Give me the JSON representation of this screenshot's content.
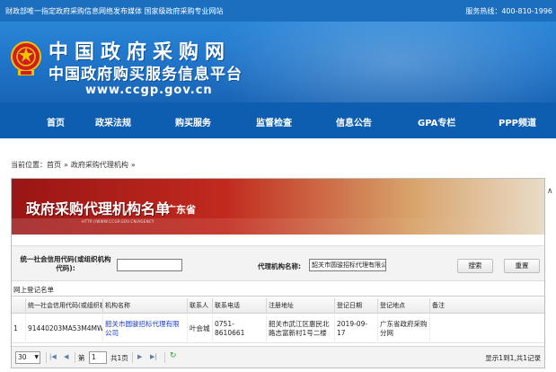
{
  "topbar": {
    "left_text": "财政部唯一指定政府采购信息网络发布媒体  国家级政府采购专业网站",
    "hotline": "服务热线：400-810-1996"
  },
  "banner": {
    "title_main": "中国政府采购网",
    "title_sub": "中国政府购买服务信息平台",
    "url": "www.ccgp.gov.cn"
  },
  "nav": {
    "items": [
      "首页",
      "政采法规",
      "购买服务",
      "监督检查",
      "信息公告",
      "GPA专栏",
      "PPP频道"
    ]
  },
  "breadcrumb": {
    "prefix": "当前位置：",
    "home": "首页",
    "separator": "»",
    "current": "政府采购代理机构",
    "trail": "»"
  },
  "list_header": {
    "title": "政府采购代理机构名单",
    "region": "广东省",
    "subtitle": "HTTP://WWW.CCGP.GOV.CN/AGENCY"
  },
  "search_form": {
    "code_label": "统一社会信用代码(或组织机构代码):",
    "code_value": "",
    "name_label": "代理机构名称:",
    "name_value": "韶关市圆骏招标代理有限公司",
    "search_button": "搜索",
    "reset_button": "重置"
  },
  "grid": {
    "title": "网上登记名单",
    "columns": [
      "",
      "统一社会信用代码(或组织机构代码)",
      "机构名称",
      "联系人",
      "联系电话",
      "注册地址",
      "登记日期",
      "登记地点",
      "备注"
    ],
    "rows": [
      {
        "index": "1",
        "code": "91440203MA53M4MW15",
        "name": "韶关市圆骏招标代理有限公司",
        "contact": "叶会城",
        "phone": "0751-8610661",
        "address": "韶关市武江区惠民北路志富新村1号二楼",
        "date": "2019-09-17",
        "place": "广东省政府采购分网",
        "remark": ""
      }
    ]
  },
  "pager": {
    "page_size": "30",
    "page_prefix": "第",
    "page_value": "1",
    "page_total": "共1页",
    "info": "显示1到1,共1记录"
  },
  "colors": {
    "topbar": "#1c6fbf",
    "nav": "#0d5eb0",
    "header_red": "#c12a1e",
    "link": "#1a3cc8"
  }
}
